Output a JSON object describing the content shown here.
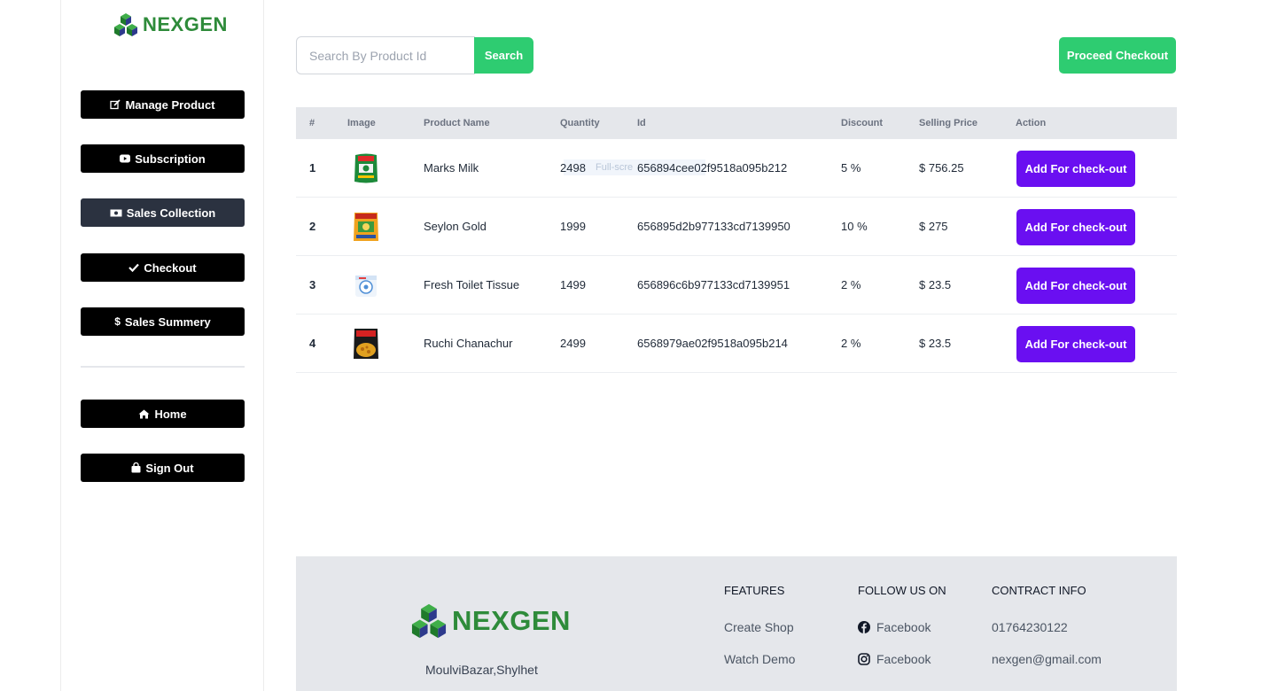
{
  "brand": {
    "name": "NEXGEN",
    "color": "#2e8b3a"
  },
  "sidebar": {
    "items": [
      {
        "label": "Manage Product",
        "icon": "edit-icon"
      },
      {
        "label": "Subscription",
        "icon": "youtube-icon"
      },
      {
        "label": "Sales Collection",
        "icon": "money-bill-icon",
        "active": true
      },
      {
        "label": "Checkout",
        "icon": "check-icon"
      },
      {
        "label": "Sales Summery",
        "icon": "dollar-icon"
      }
    ],
    "bottom_items": [
      {
        "label": "Home",
        "icon": "home-icon"
      },
      {
        "label": "Sign Out",
        "icon": "shopping-bag-icon"
      }
    ]
  },
  "search": {
    "placeholder": "Search By Product Id",
    "button_label": "Search"
  },
  "proceed_checkout_label": "Proceed Checkout",
  "table": {
    "headers": [
      "#",
      "Image",
      "Product Name",
      "Quantity",
      "Id",
      "Discount",
      "Selling Price",
      "Action"
    ],
    "rows": [
      {
        "num": "1",
        "image": "milk-pack-image",
        "name": "Marks Milk",
        "quantity": "2498",
        "id": "656894cee02f9518a095b212",
        "discount": "5 %",
        "price": "$ 756.25",
        "action": "Add For check-out"
      },
      {
        "num": "2",
        "image": "tea-pack-image",
        "name": "Seylon Gold",
        "quantity": "1999",
        "id": "656895d2b977133cd7139950",
        "discount": "10 %",
        "price": "$ 275",
        "action": "Add For check-out"
      },
      {
        "num": "3",
        "image": "tissue-roll-image",
        "name": "Fresh Toilet Tissue",
        "quantity": "1499",
        "id": "656896c6b977133cd7139951",
        "discount": "2 %",
        "price": "$ 23.5",
        "action": "Add For check-out"
      },
      {
        "num": "4",
        "image": "chanachur-pack-image",
        "name": "Ruchi Chanachur",
        "quantity": "2499",
        "id": "6568979ae02f9518a095b214",
        "discount": "2 %",
        "price": "$ 23.5",
        "action": "Add For check-out"
      }
    ],
    "overlay_label": "Full-scre"
  },
  "footer": {
    "brand_name": "NEXGEN",
    "address": "MoulviBazar,Shylhet",
    "features": {
      "heading": "FEATURES",
      "links": [
        "Create Shop",
        "Watch Demo"
      ]
    },
    "follow": {
      "heading": "FOLLOW US ON",
      "links": [
        {
          "label": "Facebook",
          "icon": "facebook-icon"
        },
        {
          "label": "Facebook",
          "icon": "instagram-icon"
        }
      ]
    },
    "contact": {
      "heading": "CONTRACT INFO",
      "phone": "01764230122",
      "email": "nexgen@gmail.com"
    }
  },
  "colors": {
    "green": "#2ecc71",
    "purple": "#6a0ff1",
    "nav_black": "#000000",
    "nav_active": "#2b3240"
  }
}
